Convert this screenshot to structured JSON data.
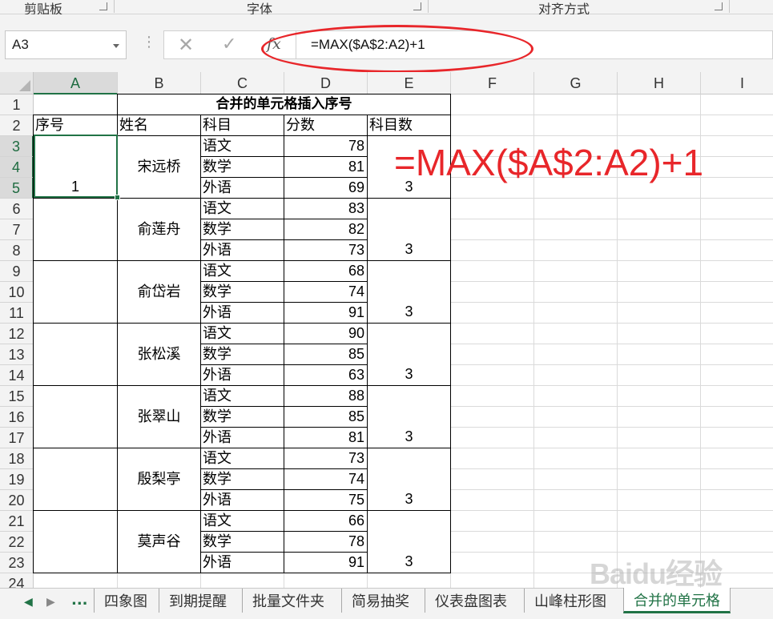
{
  "ribbon": {
    "groups": [
      "剪贴板",
      "字体",
      "对齐方式"
    ]
  },
  "formula_bar": {
    "name_box": "A3",
    "formula": "=MAX($A$2:A2)+1",
    "fx_label": "fx"
  },
  "columns": [
    "A",
    "B",
    "C",
    "D",
    "E",
    "F",
    "G",
    "H",
    "I"
  ],
  "rows": [
    "1",
    "2",
    "3",
    "4",
    "5",
    "6",
    "7",
    "8",
    "9",
    "10",
    "11",
    "12",
    "13",
    "14",
    "15",
    "16",
    "17",
    "18",
    "19",
    "20",
    "21",
    "22",
    "23",
    "24"
  ],
  "sheet": {
    "title": "合并的单元格插入序号",
    "headers": [
      "序号",
      "姓名",
      "科目",
      "分数",
      "科目数"
    ],
    "first_serial": "1",
    "students": [
      {
        "name": "宋远桥",
        "subjects": [
          "语文",
          "数学",
          "外语"
        ],
        "scores": [
          "78",
          "81",
          "69"
        ],
        "count": "3"
      },
      {
        "name": "俞莲舟",
        "subjects": [
          "语文",
          "数学",
          "外语"
        ],
        "scores": [
          "83",
          "82",
          "73"
        ],
        "count": "3"
      },
      {
        "name": "俞岱岩",
        "subjects": [
          "语文",
          "数学",
          "外语"
        ],
        "scores": [
          "68",
          "74",
          "91"
        ],
        "count": "3"
      },
      {
        "name": "张松溪",
        "subjects": [
          "语文",
          "数学",
          "外语"
        ],
        "scores": [
          "90",
          "85",
          "63"
        ],
        "count": "3"
      },
      {
        "name": "张翠山",
        "subjects": [
          "语文",
          "数学",
          "外语"
        ],
        "scores": [
          "88",
          "85",
          "81"
        ],
        "count": "3"
      },
      {
        "name": "殷梨亭",
        "subjects": [
          "语文",
          "数学",
          "外语"
        ],
        "scores": [
          "73",
          "74",
          "75"
        ],
        "count": "3"
      },
      {
        "name": "莫声谷",
        "subjects": [
          "语文",
          "数学",
          "外语"
        ],
        "scores": [
          "66",
          "78",
          "91"
        ],
        "count": "3"
      }
    ]
  },
  "annotation": {
    "formula_overlay": "=MAX($A$2:A2)+1",
    "highlight_color": "#e8262a"
  },
  "tabs": {
    "more": "...",
    "items": [
      "四象图",
      "到期提醒",
      "批量文件夹",
      "简易抽奖",
      "仪表盘图表",
      "山峰柱形图",
      "合并的单元格"
    ],
    "active": "合并的单元格"
  },
  "watermark": "Baidu经验",
  "colors": {
    "excel_green": "#217346",
    "annotation_red": "#e8262a"
  }
}
